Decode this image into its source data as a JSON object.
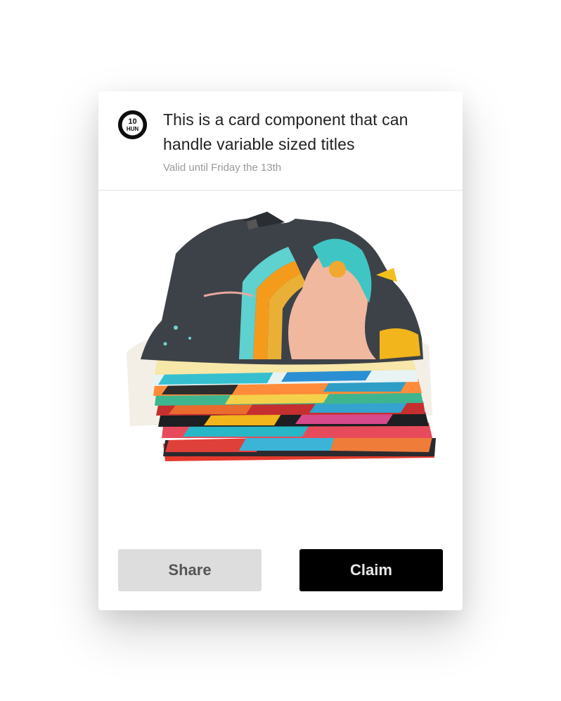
{
  "card": {
    "avatar": {
      "icon": "brand-logo-icon",
      "logo_text": "10 HUN"
    },
    "title": "This is a card component that can handle variable sized titles",
    "subtitle": "Valid until Friday the 13th",
    "image": {
      "icon": "folded-tshirts-image"
    },
    "actions": {
      "share_label": "Share",
      "claim_label": "Claim"
    }
  },
  "colors": {
    "share_bg": "#dddddd",
    "share_text": "#555555",
    "claim_bg": "#000000",
    "claim_text": "#e8e8e8",
    "subtitle": "#999999",
    "title": "#222222"
  }
}
